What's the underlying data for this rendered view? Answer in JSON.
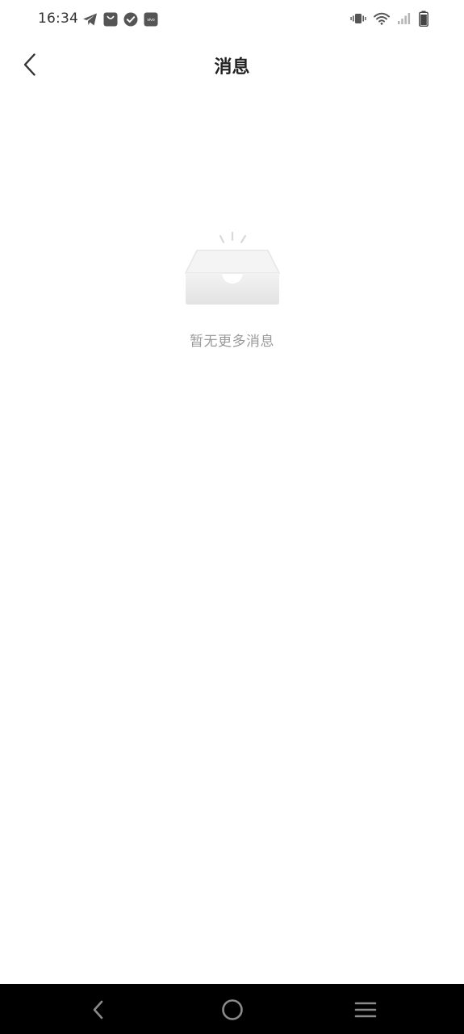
{
  "status_bar": {
    "time": "16:34",
    "left_icons": [
      "telegram-icon",
      "shopping-bag-icon",
      "check-circle-icon",
      "vivo-icon"
    ],
    "vivo_label": "vivo",
    "right_icons": [
      "vibrate-icon",
      "wifi-icon",
      "signal-icon",
      "battery-icon"
    ]
  },
  "header": {
    "title": "消息",
    "back_icon": "chevron-left-icon"
  },
  "empty_state": {
    "icon": "empty-inbox-icon",
    "text": "暂无更多消息"
  },
  "nav_bar": {
    "buttons": [
      "back-triangle-icon",
      "home-circle-icon",
      "menu-lines-icon"
    ]
  },
  "colors": {
    "title": "#222222",
    "empty_text": "#9a9a9a",
    "nav_background": "#000000",
    "nav_icon": "#8a8a8a"
  }
}
